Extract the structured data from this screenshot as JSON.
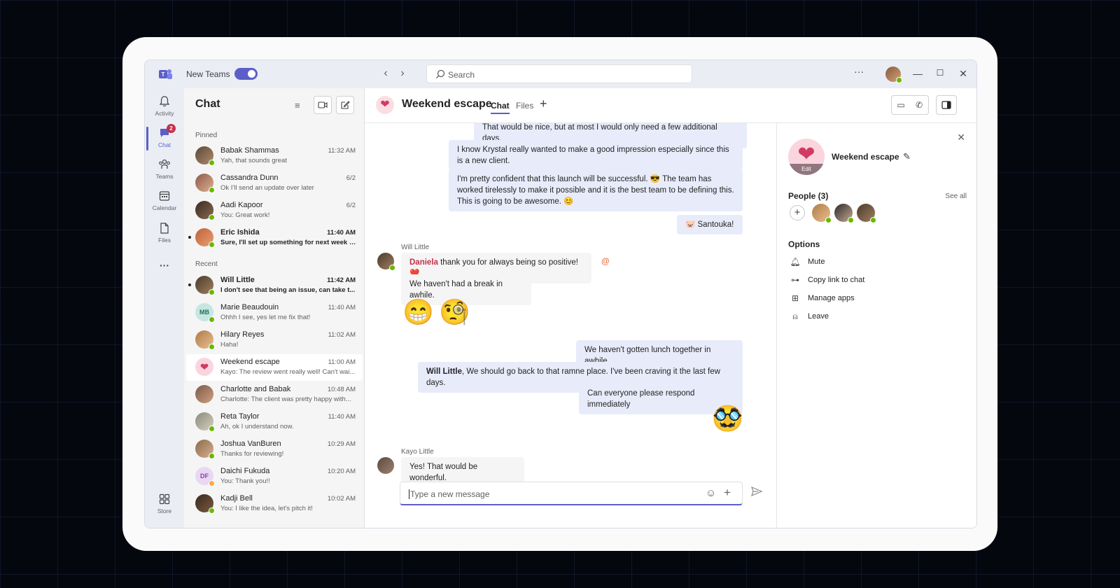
{
  "titlebar": {
    "toggle_label": "New Teams",
    "search_placeholder": "Search",
    "more": "···"
  },
  "rail": [
    {
      "label": "Activity",
      "icon": "bell-icon"
    },
    {
      "label": "Chat",
      "icon": "chat-icon",
      "badge": "2"
    },
    {
      "label": "Teams",
      "icon": "teams-icon"
    },
    {
      "label": "Calendar",
      "icon": "calendar-icon"
    },
    {
      "label": "Files",
      "icon": "files-icon"
    },
    {
      "label": "···",
      "icon": "more-apps-icon"
    },
    {
      "label": "Store",
      "icon": "store-icon"
    }
  ],
  "chatlist": {
    "title": "Chat",
    "pinned_label": "Pinned",
    "recent_label": "Recent",
    "pinned": [
      {
        "name": "Babak Shammas",
        "time": "11:32 AM",
        "preview": "Yah, that sounds great"
      },
      {
        "name": "Cassandra Dunn",
        "time": "6/2",
        "preview": "Ok I'll send an update over later"
      },
      {
        "name": "Aadi Kapoor",
        "time": "6/2",
        "preview": "You: Great work!"
      },
      {
        "name": "Eric Ishida",
        "time": "11:40 AM",
        "preview": "Sure, I'll set up something for next week to..."
      }
    ],
    "recent": [
      {
        "name": "Will Little",
        "time": "11:42 AM",
        "preview": "I don't see that being an issue, can take t..."
      },
      {
        "name": "Marie Beaudouin",
        "time": "11:40 AM",
        "preview": "Ohhh I see, yes let me fix that!",
        "initials": "MB"
      },
      {
        "name": "Hilary Reyes",
        "time": "11:02 AM",
        "preview": "Haha!"
      },
      {
        "name": "Weekend escape",
        "time": "11:00 AM",
        "preview": "Kayo: The review went really well! Can't wai..."
      },
      {
        "name": "Charlotte and Babak",
        "time": "10:48 AM",
        "preview": "Charlotte: The client was pretty happy with..."
      },
      {
        "name": "Reta Taylor",
        "time": "11:40 AM",
        "preview": "Ah, ok I understand now."
      },
      {
        "name": "Joshua VanBuren",
        "time": "10:29 AM",
        "preview": "Thanks for reviewing!"
      },
      {
        "name": "Daichi Fukuda",
        "time": "10:20 AM",
        "preview": "You: Thank you!!",
        "initials": "DF"
      },
      {
        "name": "Kadji Bell",
        "time": "10:02 AM",
        "preview": "You: I like the idea, let's pitch it!"
      }
    ]
  },
  "header": {
    "title": "Weekend escape",
    "tabs": [
      "Chat",
      "Files"
    ]
  },
  "messages": {
    "m1": "That would be nice, but at most I would only need a few additional days.",
    "m2": "I know Krystal really wanted to make a good impression especially since this is a new client.",
    "m3a": "I'm pretty confident that this launch will be successful. 😎 The team has worked tirelessly to make it possible and it is the best team to be defining this. This is going to be awesome. 😊",
    "m4": "🐷 Santouka!",
    "sender_will": "Will Little",
    "mention_daniela": "Daniela",
    "m5_rest": " thank you for always being so positive! ❤️",
    "m6": "We haven't had a break in awhile.",
    "emoji1": "😁",
    "emoji2": "🧐",
    "m7": "We haven't gotten lunch together in awhile",
    "m8_bold": "Will Little",
    "m8_rest": ", We should go back to that ramne place. I've been craving it the last few days.",
    "m9": "Can everyone please respond immediately",
    "emoji3": "🥸",
    "sender_kayo": "Kayo Little",
    "m10": "Yes! That would be wonderful."
  },
  "composer": {
    "placeholder": "Type a new message"
  },
  "details": {
    "group_name": "Weekend escape",
    "edit_label": "Edit",
    "people_label": "People (3)",
    "see_all": "See all",
    "options_label": "Options",
    "options": [
      {
        "label": "Mute",
        "icon": "bell-icon"
      },
      {
        "label": "Copy link to chat",
        "icon": "link-icon"
      },
      {
        "label": "Manage apps",
        "icon": "apps-icon"
      },
      {
        "label": "Leave",
        "icon": "leave-icon"
      }
    ]
  },
  "colors": {
    "accent": "#5b5fc7",
    "presence": "#6bb700",
    "badge": "#c4314b",
    "mention": "#c4314b"
  }
}
